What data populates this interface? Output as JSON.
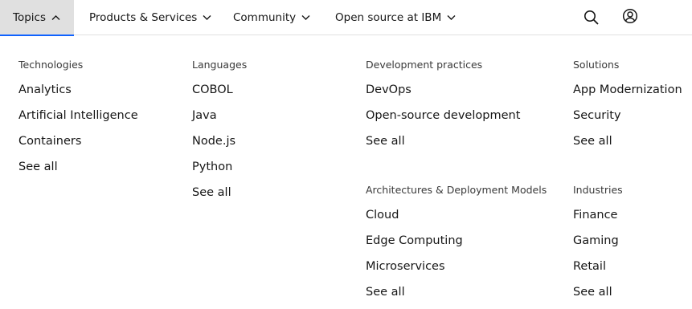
{
  "nav": {
    "items": [
      {
        "label": "Topics",
        "active": true
      },
      {
        "label": "Products & Services",
        "active": false
      },
      {
        "label": "Community",
        "active": false
      },
      {
        "label": "Open source at IBM",
        "active": false
      }
    ],
    "icons": [
      "search-icon",
      "user-profile-icon"
    ]
  },
  "menu": {
    "technologies": {
      "title": "Technologies",
      "links": [
        "Analytics",
        "Artificial Intelligence",
        "Containers",
        "See all"
      ]
    },
    "languages": {
      "title": "Languages",
      "links": [
        "COBOL",
        "Java",
        "Node.js",
        "Python",
        "See all"
      ]
    },
    "development_practices": {
      "title": "Development practices",
      "links": [
        "DevOps",
        "Open-source development",
        "See all"
      ]
    },
    "architectures": {
      "title": "Architectures & Deployment Models",
      "links": [
        "Cloud",
        "Edge Computing",
        "Microservices",
        "See all"
      ]
    },
    "solutions": {
      "title": "Solutions",
      "links": [
        "App Modernization",
        "Security",
        "See all"
      ]
    },
    "industries": {
      "title": "Industries",
      "links": [
        "Finance",
        "Gaming",
        "Retail",
        "See all"
      ]
    }
  },
  "colors": {
    "active_tab_bg": "#e0e0e0",
    "active_tab_underline": "#0f62fe",
    "text": "#161616",
    "heading": "#393939"
  }
}
